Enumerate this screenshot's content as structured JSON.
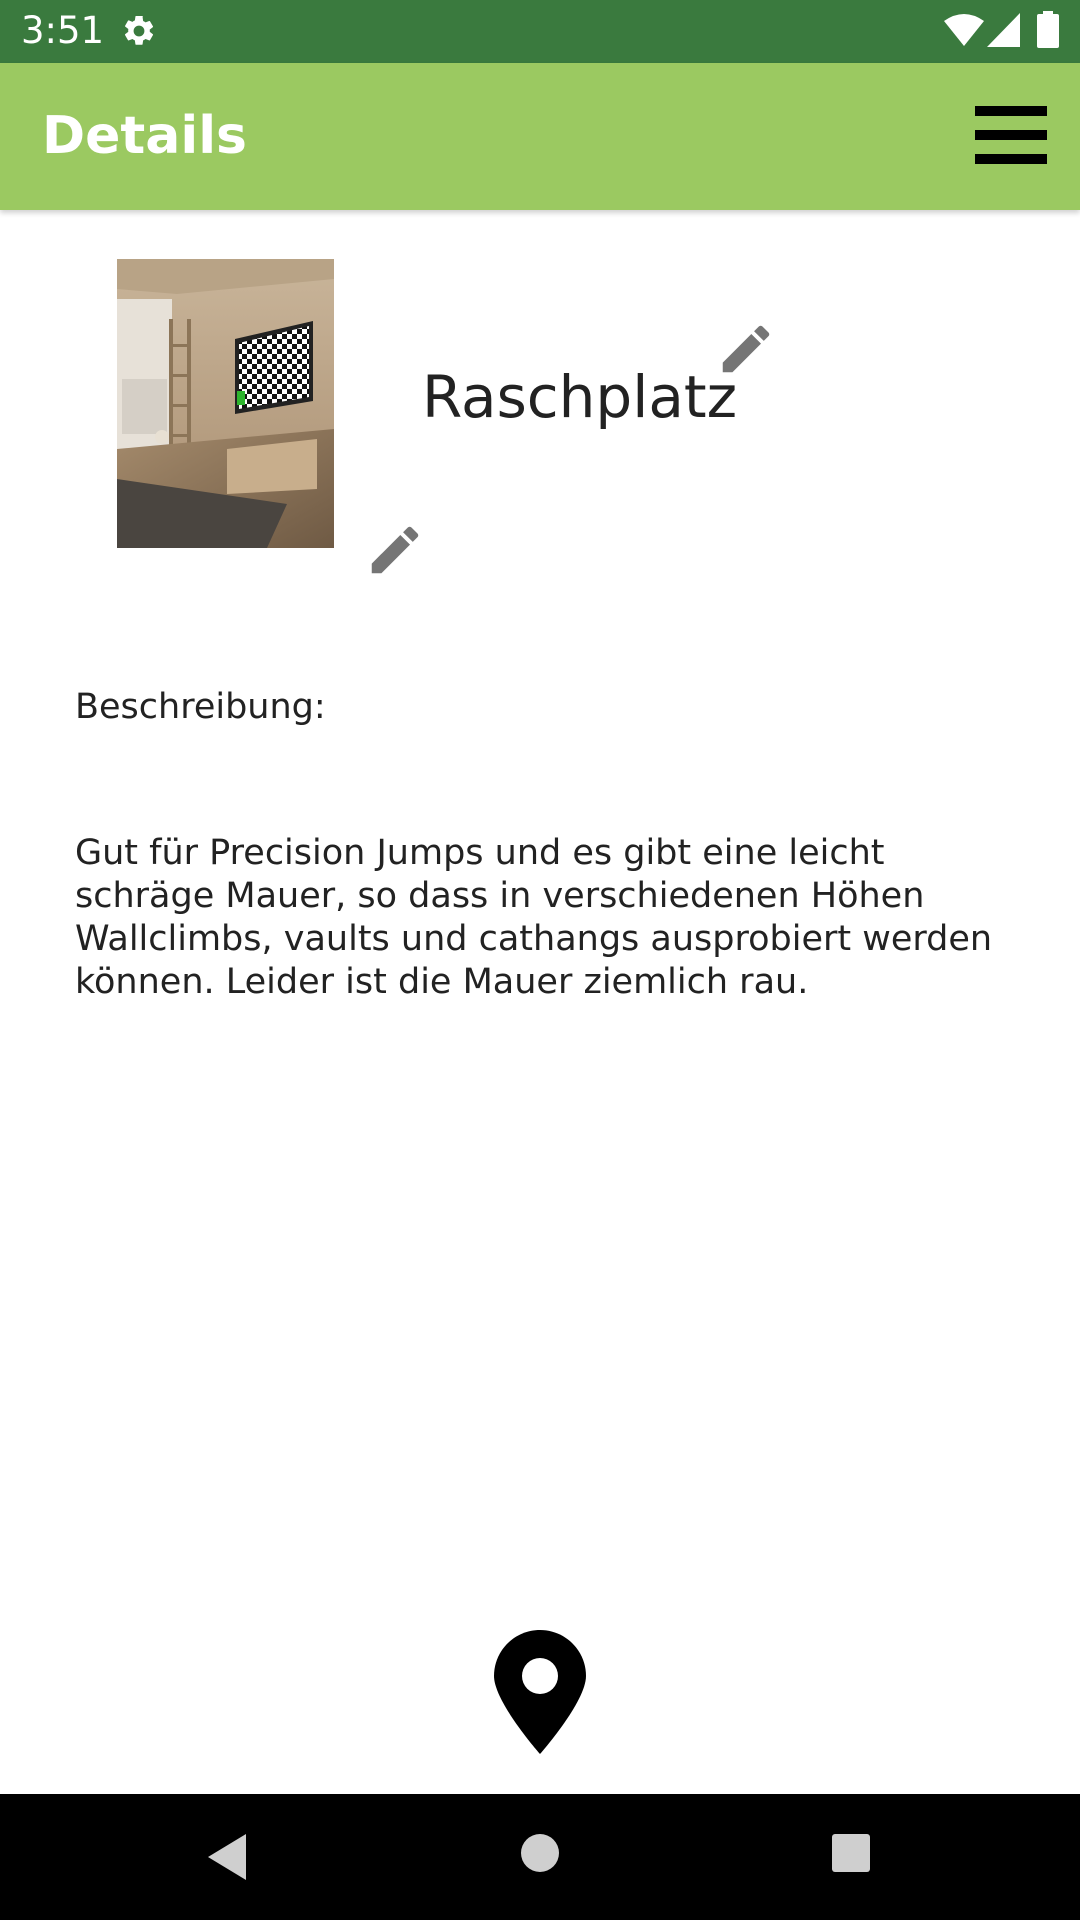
{
  "status_bar": {
    "time": "3:51",
    "icons": [
      "gear-icon",
      "wifi-icon",
      "signal-icon",
      "battery-icon"
    ]
  },
  "app_bar": {
    "title": "Details",
    "menu_icon": "hamburger-menu-icon"
  },
  "place": {
    "name": "Raschplatz",
    "image_icon": "room-photo",
    "edit_icon": "pencil-icon"
  },
  "description": {
    "label": "Beschreibung:",
    "text": "Gut für Precision Jumps und es gibt eine leicht schräge Mauer, so dass in verschiedenen Höhen Wallclimbs, vaults und cathangs ausprobiert werden können. Leider ist die Mauer ziemlich rau."
  },
  "actions": {
    "map_icon": "map-pin-icon"
  },
  "nav_bar": {
    "icons": [
      "back-icon",
      "home-icon",
      "recents-icon"
    ]
  },
  "colors": {
    "status_bar": "#3a7a3e",
    "app_bar": "#9bc961",
    "app_title": "#ffffff",
    "icon_gray": "#757575",
    "text": "#222222",
    "nav_bar": "#000000"
  }
}
